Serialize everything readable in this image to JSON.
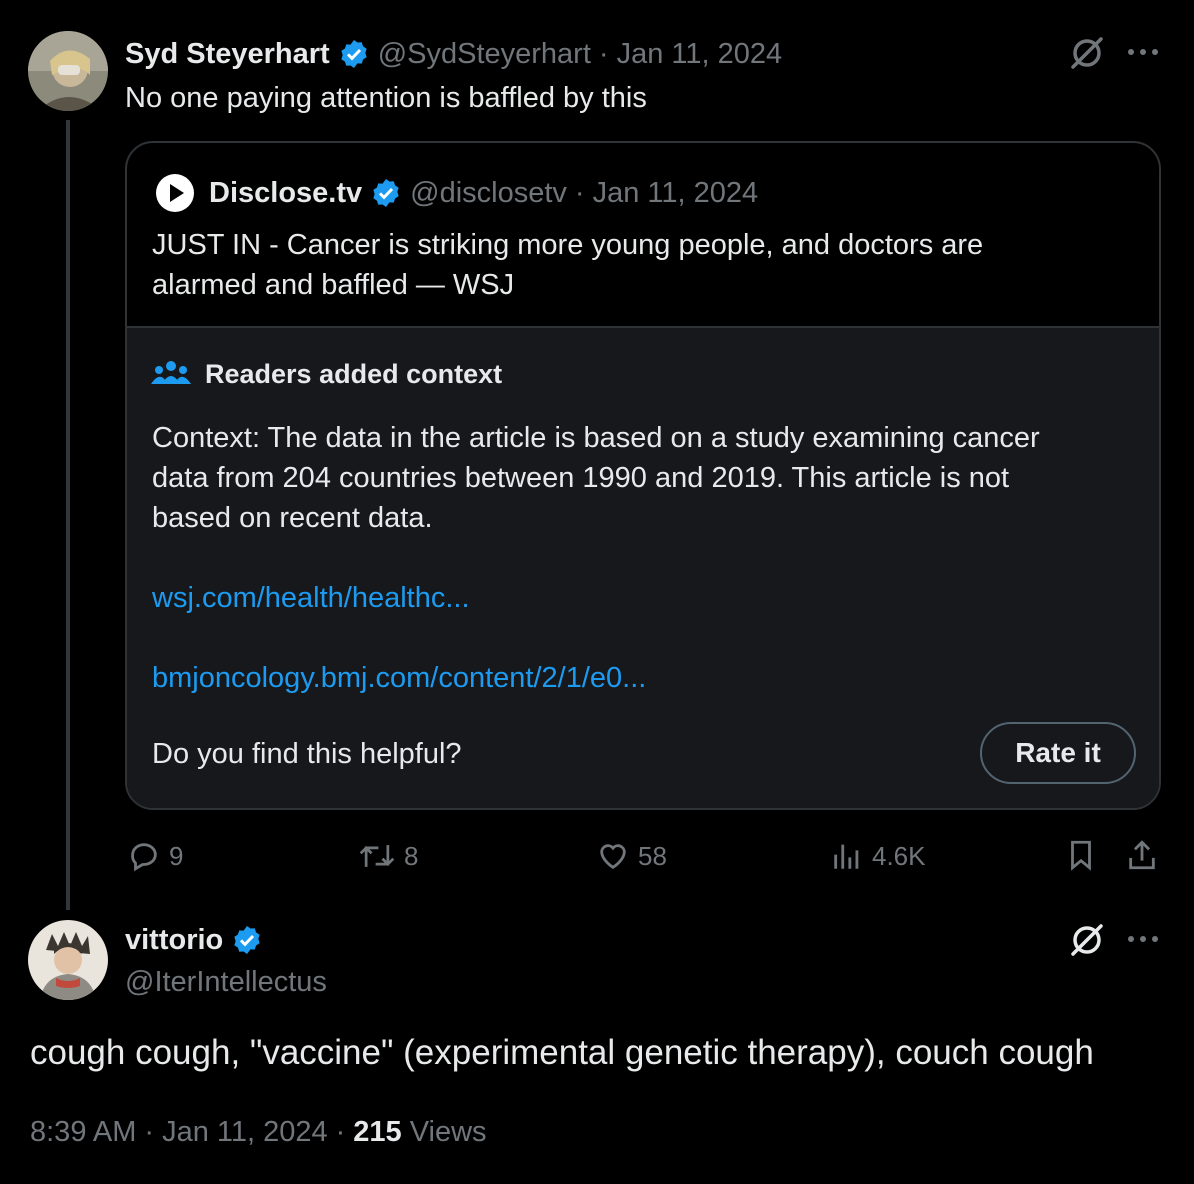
{
  "tweet1": {
    "name": "Syd Steyerhart",
    "handle": "@SydSteyerhart",
    "sep": "·",
    "date": "Jan 11, 2024",
    "text": "No one paying attention is baffled by this",
    "quote": {
      "name": "Disclose.tv",
      "handle": "@disclosetv",
      "sep": "·",
      "date": "Jan 11, 2024",
      "text_line1": "JUST IN - Cancer is striking more young people, and doctors are",
      "text_line2": "alarmed and baffled — WSJ"
    },
    "context": {
      "title": "Readers added context",
      "line1": "Context: The data in the article is based on a study examining cancer",
      "line2": "data from 204 countries between 1990 and 2019. This article is not",
      "line3": "based on recent data.",
      "link1": "wsj.com/health/healthc...",
      "link2": "bmjoncology.bmj.com/content/2/1/e0...",
      "question": "Do you find this helpful?",
      "rate_label": "Rate it"
    },
    "actions": {
      "replies": "9",
      "reposts": "8",
      "likes": "58",
      "views": "4.6K"
    }
  },
  "tweet2": {
    "name": "vittorio",
    "handle": "@IterIntellectus",
    "text": "cough cough, \"vaccine\" (experimental genetic therapy), couch cough",
    "time": "8:39 AM",
    "sep1": "·",
    "date": "Jan 11, 2024",
    "sep2": "·",
    "views_count": "215",
    "views_label": "Views"
  },
  "colors": {
    "background": "#000000",
    "text": "#e7e9ea",
    "muted": "#71767b",
    "link": "#1d9bf0",
    "verified": "#1d9bf0",
    "border": "#2f3336",
    "context_bg": "#16181c"
  }
}
